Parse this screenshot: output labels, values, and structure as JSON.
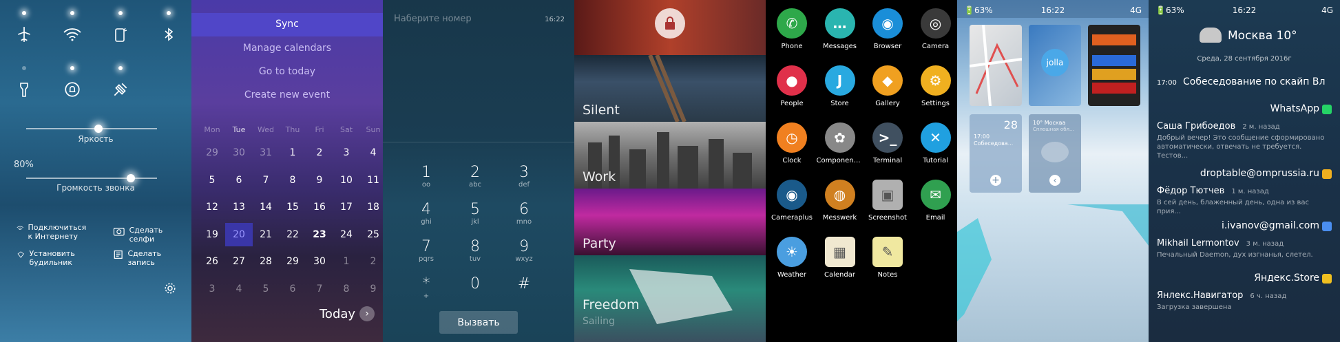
{
  "panel1": {
    "brightness_label": "Яркость",
    "volume_percent": "80%",
    "volume_label": "Громкость звонка",
    "brightness_level": 0.55,
    "volume_level": 0.8,
    "shortcuts": [
      {
        "icon": "wifi-icon",
        "label": "Подключиться к Интернету"
      },
      {
        "icon": "camera-icon",
        "label": "Сделать селфи"
      },
      {
        "icon": "alarm-icon",
        "label": "Установить будильник"
      },
      {
        "icon": "note-icon",
        "label": "Сделать запись"
      }
    ]
  },
  "panel2": {
    "menu": [
      "Sync",
      "Manage calendars",
      "Go to today",
      "Create new event"
    ],
    "weekdays": [
      "Mon",
      "Tue",
      "Wed",
      "Thu",
      "Fri",
      "Sat",
      "Sun"
    ],
    "weeks": [
      [
        "29",
        "30",
        "31",
        "1",
        "2",
        "3",
        "4"
      ],
      [
        "5",
        "6",
        "7",
        "8",
        "9",
        "10",
        "11"
      ],
      [
        "12",
        "13",
        "14",
        "15",
        "16",
        "17",
        "18"
      ],
      [
        "19",
        "20",
        "21",
        "22",
        "23",
        "24",
        "25"
      ],
      [
        "26",
        "27",
        "28",
        "29",
        "30",
        "1",
        "2"
      ],
      [
        "3",
        "4",
        "5",
        "6",
        "7",
        "8",
        "9"
      ]
    ],
    "selected_day": "20",
    "today_label": "Today"
  },
  "panel3": {
    "placeholder": "Наберите номер",
    "time": "16:22",
    "keys": [
      {
        "n": "1",
        "s": "oo"
      },
      {
        "n": "2",
        "s": "abc"
      },
      {
        "n": "3",
        "s": "def"
      },
      {
        "n": "4",
        "s": "ghi"
      },
      {
        "n": "5",
        "s": "jkl"
      },
      {
        "n": "6",
        "s": "mno"
      },
      {
        "n": "7",
        "s": "pqrs"
      },
      {
        "n": "8",
        "s": "tuv"
      },
      {
        "n": "9",
        "s": "wxyz"
      },
      {
        "n": "*",
        "s": "+"
      },
      {
        "n": "0",
        "s": ""
      },
      {
        "n": "#",
        "s": ""
      }
    ],
    "call_button": "Вызвать"
  },
  "panel4": {
    "ambiences": [
      "Silent",
      "Work",
      "Party",
      "Freedom",
      "Sailing"
    ]
  },
  "panel5": {
    "apps": [
      {
        "name": "Phone",
        "color": "#2ea84a",
        "icon": "phone-icon"
      },
      {
        "name": "Messages",
        "color": "#2ab5b0",
        "icon": "messages-icon"
      },
      {
        "name": "Browser",
        "color": "#1a8ed8",
        "icon": "browser-icon"
      },
      {
        "name": "Camera",
        "color": "#3a3a3a",
        "icon": "camera-icon"
      },
      {
        "name": "People",
        "color": "#e0304a",
        "icon": "people-icon"
      },
      {
        "name": "Store",
        "color": "#29a9e0",
        "icon": "store-icon"
      },
      {
        "name": "Gallery",
        "color": "#f0a020",
        "icon": "gallery-icon"
      },
      {
        "name": "Settings",
        "color": "#f0b020",
        "icon": "settings-icon"
      },
      {
        "name": "Clock",
        "color": "#f08020",
        "icon": "clock-icon"
      },
      {
        "name": "Components...",
        "color": "#888888",
        "icon": "components-icon"
      },
      {
        "name": "Terminal",
        "color": "#405060",
        "icon": "terminal-icon"
      },
      {
        "name": "Tutorial",
        "color": "#20a0e0",
        "icon": "tutorial-icon"
      },
      {
        "name": "Cameraplus",
        "color": "#1a5a8a",
        "icon": "cameraplus-icon"
      },
      {
        "name": "Messwerk",
        "color": "#d08020",
        "icon": "messwerk-icon"
      },
      {
        "name": "Screenshot",
        "color": "#b0b0b0",
        "icon": "screenshot-icon"
      },
      {
        "name": "Email",
        "color": "#30a050",
        "icon": "email-icon"
      },
      {
        "name": "Weather",
        "color": "#4a9ee0",
        "icon": "weather-icon"
      },
      {
        "name": "Calendar",
        "color": "#f0e8d0",
        "icon": "calendar-icon"
      },
      {
        "name": "Notes",
        "color": "#f0e8a0",
        "icon": "notes-icon"
      }
    ]
  },
  "panel6": {
    "battery": "63%",
    "time": "16:22",
    "network": "4G",
    "cal_day": "28",
    "cal_time": "17:00",
    "cal_event": "Собеседова...",
    "weather": "10° Москва",
    "weather_sub": "Сплошная обл..."
  },
  "panel7": {
    "battery": "63%",
    "time": "16:22",
    "network": "4G",
    "weather_title": "Москва 10°",
    "date": "Среда, 28 сентября 2016г",
    "event_time": "17:00",
    "event_title": "Собеседование по скайп Вл",
    "groups": [
      {
        "title": "WhatsApp",
        "color": "#25d366",
        "items": [
          {
            "name": "Саша Грибоедов",
            "time": "2 м. назад",
            "body": "Добрый вечер! Это сообщение сформировано автоматически, отвечать не требуется. Тестов..."
          }
        ]
      },
      {
        "title": "droptable@omprussia.ru",
        "color": "#f0b020",
        "items": [
          {
            "name": "Фёдор Тютчев",
            "time": "1 м. назад",
            "body": "В сей день, блаженный день, одна из вас прия..."
          }
        ]
      },
      {
        "title": "i.ivanov@gmail.com",
        "color": "#4a8ef0",
        "items": [
          {
            "name": "Mikhail Lermontov",
            "time": "3 м. назад",
            "body": "Печальный Daemon, дух изгнанья, слетел."
          }
        ]
      },
      {
        "title": "Яндекс.Store",
        "color": "#f0c020",
        "items": [
          {
            "name": "Янлекс.Навигатор",
            "time": "6 ч. назад",
            "body": "Загрузка завершена"
          }
        ]
      }
    ]
  }
}
